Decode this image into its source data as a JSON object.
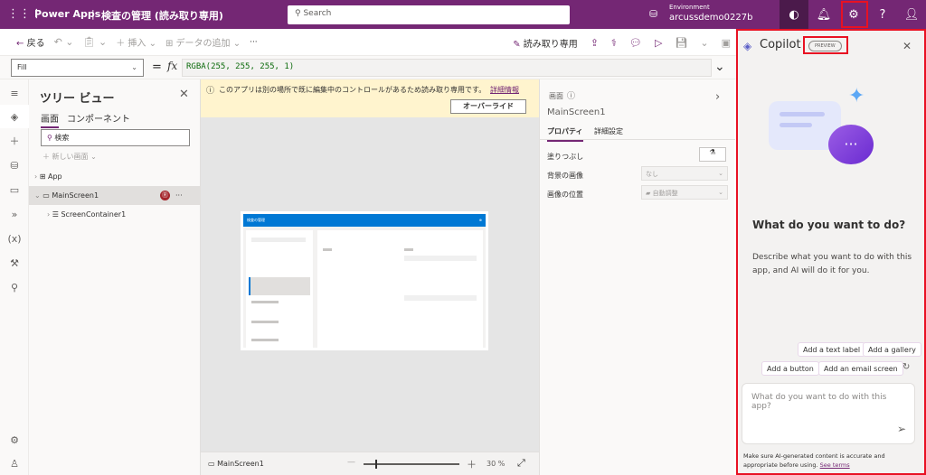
{
  "topbar": {
    "app_name": "Power Apps",
    "separator": "|",
    "doc_title": "検査の管理 (読み取り専用)",
    "search_placeholder": "Search",
    "env_label": "Environment",
    "env_name": "arcussdemo0227b"
  },
  "command_bar": {
    "back": "戻る",
    "insert": "挿入",
    "add_data": "データの追加",
    "more": "···",
    "read_only": "読み取り専用"
  },
  "formula": {
    "property": "Fill",
    "equals": "=",
    "fx": "fx",
    "value": "RGBA(255, 255, 255, 1)"
  },
  "tree": {
    "title": "ツリー ビュー",
    "tabs": [
      "画面",
      "コンポーネント"
    ],
    "search_placeholder": "検索",
    "new_screen": "新しい画面",
    "items": [
      {
        "label": "App"
      },
      {
        "label": "MainScreen1"
      },
      {
        "label": "ScreenContainer1"
      }
    ]
  },
  "banner": {
    "message": "このアプリは別の場所で既に編集中のコントロールがあるため読み取り専用です。",
    "link": "詳細情報",
    "override": "オーバーライド"
  },
  "preview_app": {
    "title": "検査の管理"
  },
  "properties": {
    "type": "画面",
    "name": "MainScreen1",
    "tabs": [
      "プロパティ",
      "詳細設定"
    ],
    "rows": [
      {
        "label": "塗りつぶし"
      },
      {
        "label": "背景の画像",
        "value": "なし"
      },
      {
        "label": "画像の位置",
        "value": "自動調整"
      }
    ]
  },
  "bottom": {
    "screen": "MainScreen1",
    "zoom": "30",
    "zoom_unit": "%",
    "zoom_fraction": 0.3
  },
  "copilot": {
    "title": "Copilot",
    "badge": "PREVIEW",
    "heading": "What do you want to do?",
    "description": "Describe what you want to do with this app, and AI will do it for you.",
    "suggestions": [
      "Add a text label",
      "Add a gallery",
      "Add a button",
      "Add an email screen"
    ],
    "input_placeholder": "What do you want to do with this app?",
    "disclaimer": "Make sure AI-generated content is accurate and appropriate before using.",
    "terms_link": "See terms"
  },
  "colors": {
    "brand": "#742774",
    "highlight": "#e81123",
    "banner": "#fff4ce"
  }
}
